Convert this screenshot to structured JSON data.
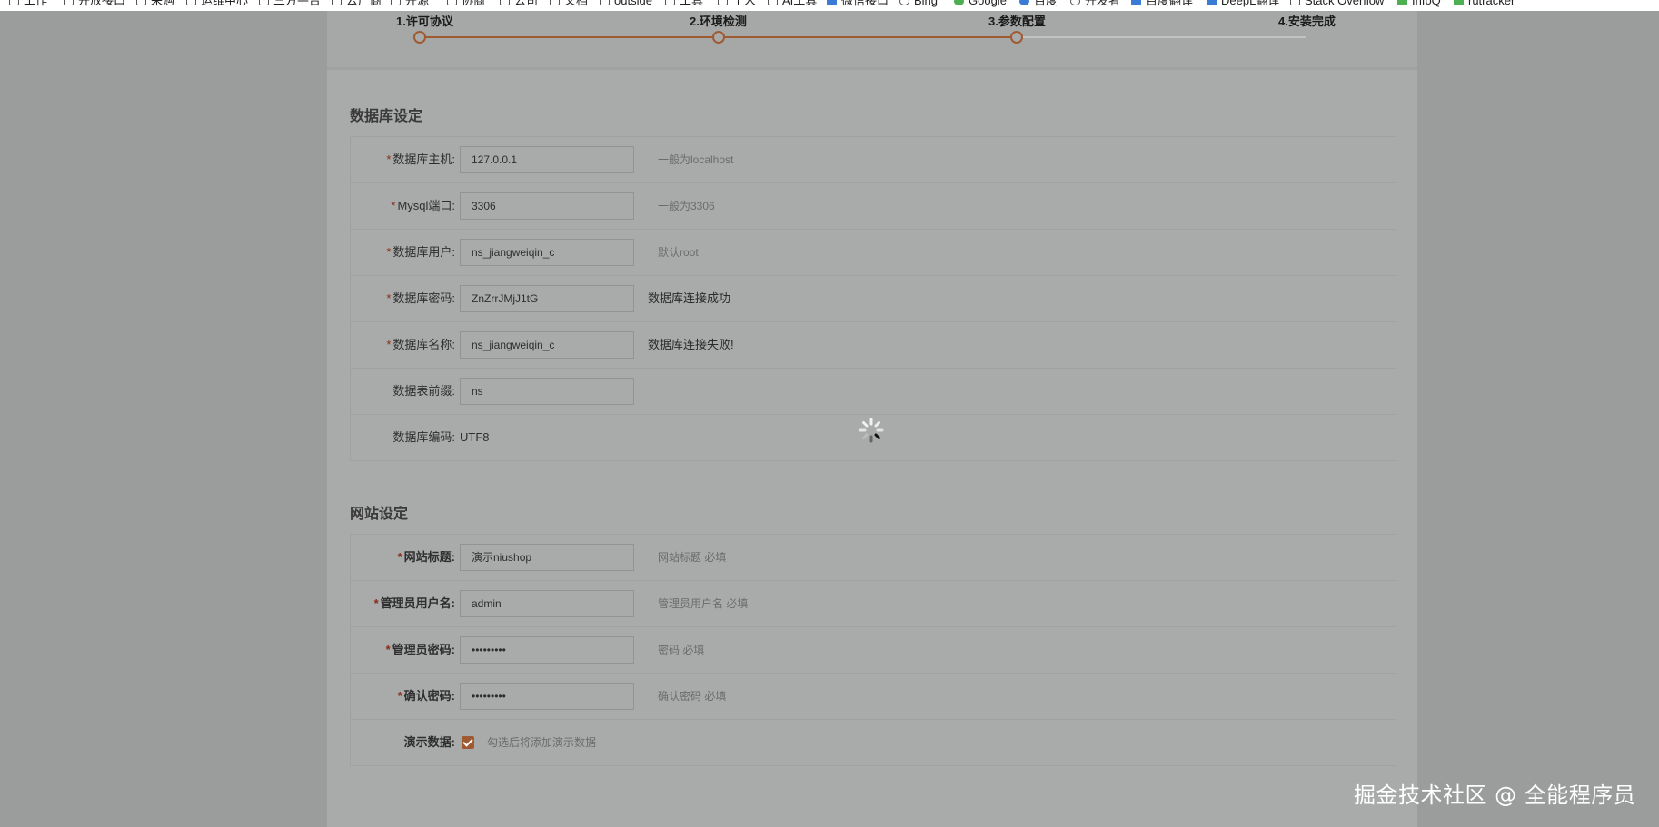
{
  "bookmarks": [
    {
      "label": "工作",
      "icon": "folder-icon"
    },
    {
      "label": "开放接口",
      "icon": "folder-icon"
    },
    {
      "label": "采购",
      "icon": "folder-icon"
    },
    {
      "label": "运维中心",
      "icon": "folder-icon"
    },
    {
      "label": "三方平台",
      "icon": "folder-icon"
    },
    {
      "label": "云产商",
      "icon": "folder-icon"
    },
    {
      "label": "开源",
      "icon": "folder-icon"
    },
    {
      "label": "协商",
      "icon": "folder-icon"
    },
    {
      "label": "公司",
      "icon": "folder-icon"
    },
    {
      "label": "文档",
      "icon": "folder-icon"
    },
    {
      "label": "outside",
      "icon": "folder-icon"
    },
    {
      "label": "工具",
      "icon": "folder-icon"
    },
    {
      "label": "个人",
      "icon": "folder-icon"
    },
    {
      "label": "AI工具",
      "icon": "folder-icon"
    },
    {
      "label": "微信接口",
      "icon": "site-icon"
    },
    {
      "label": "Bing",
      "icon": "bing-icon"
    },
    {
      "label": "Google",
      "icon": "google-icon"
    },
    {
      "label": "百度",
      "icon": "baidu-icon"
    },
    {
      "label": "开发者",
      "icon": "site-icon"
    },
    {
      "label": "百度翻译",
      "icon": "site-icon"
    },
    {
      "label": "DeepL翻译",
      "icon": "deepl-icon"
    },
    {
      "label": "Stack Overflow",
      "icon": "stackoverflow-icon"
    },
    {
      "label": "InfoQ",
      "icon": "site-icon"
    },
    {
      "label": "rutracker",
      "icon": "site-icon"
    }
  ],
  "steps": [
    {
      "label": "1.许可协议"
    },
    {
      "label": "2.环境检测"
    },
    {
      "label": "3.参数配置"
    },
    {
      "label": "4.安装完成"
    }
  ],
  "colors": {
    "accent": "#a05a32",
    "overlay": "#9a9d9b"
  },
  "database": {
    "title": "数据库设定",
    "host": {
      "label": "数据库主机:",
      "value": "127.0.0.1",
      "hint": "一般为localhost"
    },
    "port": {
      "label": "Mysql端口:",
      "value": "3306",
      "hint": "一般为3306"
    },
    "user": {
      "label": "数据库用户:",
      "value": "ns_jiangweiqin_c",
      "hint": "默认root"
    },
    "password": {
      "label": "数据库密码:",
      "value": "ZnZrrJMjJ1tG",
      "message": "数据库连接成功"
    },
    "name": {
      "label": "数据库名称:",
      "value": "ns_jiangweiqin_c",
      "message": "数据库连接失败!"
    },
    "prefix": {
      "label": "数据表前缀:",
      "value": "ns"
    },
    "charset": {
      "label": "数据库编码:",
      "value": "UTF8"
    }
  },
  "site": {
    "title": "网站设定",
    "site_title": {
      "label": "网站标题:",
      "value": "演示niushop",
      "hint": "网站标题 必填"
    },
    "admin_user": {
      "label": "管理员用户名:",
      "value": "admin",
      "hint": "管理员用户名 必填"
    },
    "admin_password": {
      "label": "管理员密码:",
      "value": "•••••••••",
      "hint": "密码 必填"
    },
    "confirm_password": {
      "label": "确认密码:",
      "value": "•••••••••",
      "hint": "确认密码 必填"
    },
    "demo_data": {
      "label": "演示数据:",
      "checked": true,
      "hint": "勾选后将添加演示数据"
    }
  },
  "required_mark": "*",
  "watermark": "掘金技术社区 @ 全能程序员"
}
